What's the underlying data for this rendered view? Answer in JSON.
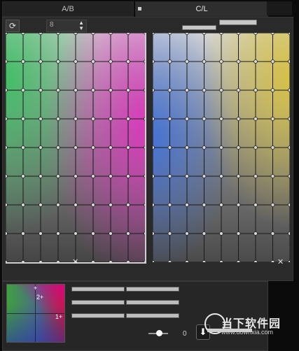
{
  "tabs": [
    {
      "label": "A/B",
      "active": false
    },
    {
      "label": "C/L",
      "active": true
    }
  ],
  "toolbar": {
    "reset_icon": "rotate-icon",
    "grid_size_value": "8"
  },
  "grid": {
    "divisions": 8
  },
  "bottom": {
    "color_labels": [
      "+",
      "2+",
      "1+"
    ],
    "slider_value": "0"
  },
  "watermark": {
    "text": "当下软件园",
    "sub": "www.downxia.com"
  },
  "colors": {
    "panel": "#2a2a2a",
    "accent": "#c8c8c8"
  }
}
